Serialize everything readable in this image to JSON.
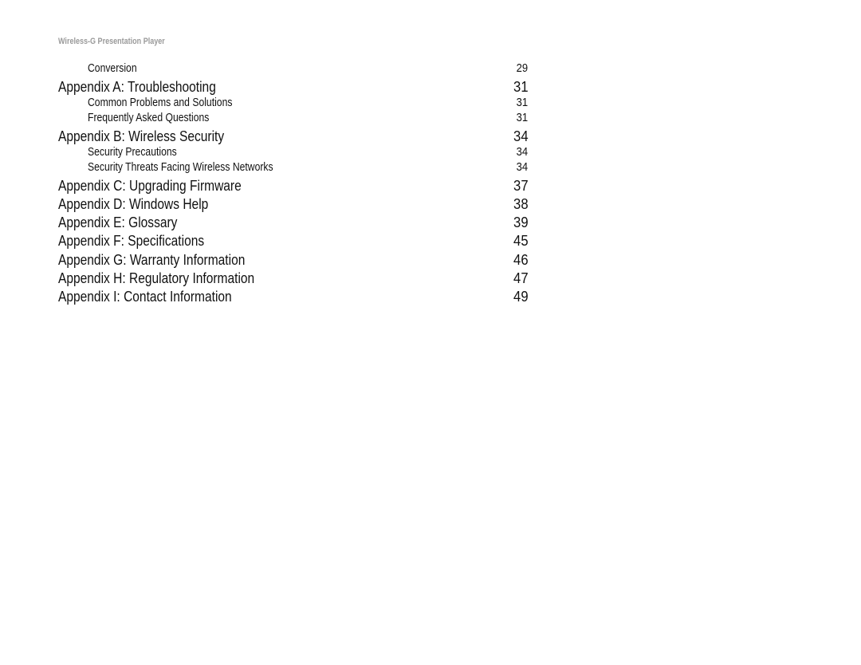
{
  "header": {
    "title": "Wireless-G Presentation Player"
  },
  "toc": {
    "entries": [
      {
        "level": "sub",
        "title": "Conversion",
        "page": "29"
      },
      {
        "level": "main",
        "title": "Appendix A: Troubleshooting",
        "page": "31"
      },
      {
        "level": "sub",
        "title": "Common Problems and Solutions",
        "page": "31"
      },
      {
        "level": "sub",
        "title": "Frequently Asked Questions",
        "page": "31"
      },
      {
        "level": "main",
        "title": "Appendix B: Wireless Security",
        "page": "34"
      },
      {
        "level": "sub",
        "title": "Security Precautions",
        "page": "34"
      },
      {
        "level": "sub",
        "title": "Security Threats Facing Wireless Networks",
        "page": "34"
      },
      {
        "level": "main",
        "title": "Appendix C: Upgrading Firmware",
        "page": "37"
      },
      {
        "level": "main",
        "title": "Appendix D: Windows Help",
        "page": "38"
      },
      {
        "level": "main",
        "title": "Appendix E: Glossary",
        "page": "39"
      },
      {
        "level": "main",
        "title": "Appendix F: Specifications",
        "page": "45"
      },
      {
        "level": "main",
        "title": "Appendix G: Warranty Information",
        "page": "46"
      },
      {
        "level": "main",
        "title": "Appendix H: Regulatory Information",
        "page": "47"
      },
      {
        "level": "main",
        "title": "Appendix I: Contact Information",
        "page": "49"
      }
    ]
  }
}
